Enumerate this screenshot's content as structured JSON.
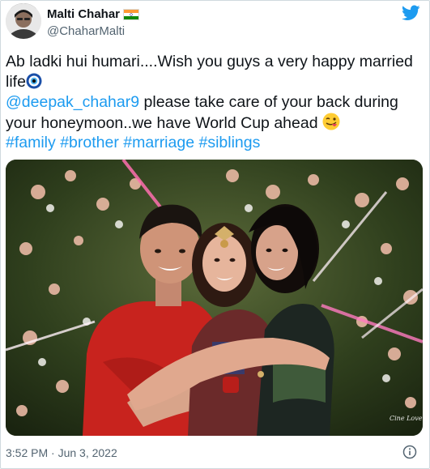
{
  "author": {
    "display_name": "Malti Chahar",
    "handle": "@ChaharMalti",
    "flag_icon": "india-flag-icon",
    "avatar_icon": "profile-avatar"
  },
  "brand": {
    "icon": "twitter-bird-icon",
    "color": "#1d9bf0"
  },
  "tweet": {
    "line1": "Ab ladki hui humari....Wish you guys a very happy married life",
    "line1_emoji": "nazar-amulet-emoji",
    "mention": "@deepak_chahar9",
    "line2": " please take care of your back during your honeymoon..we have World Cup ahead ",
    "line2_emoji": "winking-face-with-tongue-emoji",
    "hashtags": [
      "#family",
      "#brother",
      "#marriage",
      "#siblings"
    ]
  },
  "media": {
    "description_icon": "photo",
    "watermark": "Cine Love"
  },
  "footer": {
    "timestamp": "3:52 PM · Jun 3, 2022",
    "info_icon": "info-icon"
  }
}
